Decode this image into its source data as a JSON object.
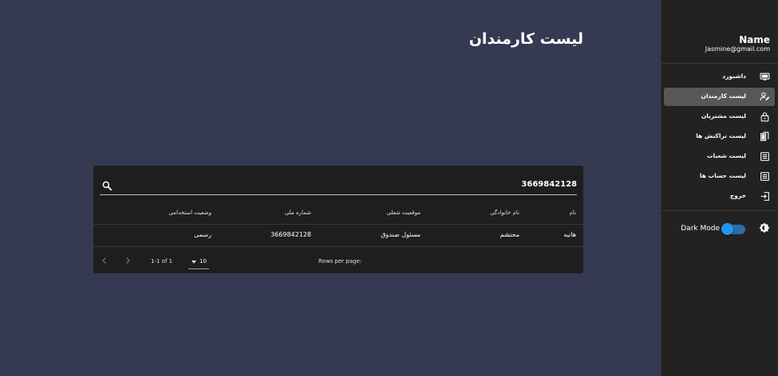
{
  "page": {
    "title": "لیست کارمندان"
  },
  "search": {
    "value": "3669842128"
  },
  "table": {
    "headers": [
      "نام",
      "نام خانوادگی",
      "موقعیت شغلی",
      "شماره ملی",
      "وضعیت استخدامی"
    ],
    "rows": [
      [
        "هانیه",
        "محتشم",
        "مسئول صندوق",
        "3669842128",
        "رسمی"
      ]
    ]
  },
  "pagination": {
    "rows_per_page_label": "Rows per page:",
    "rows_per_page_value": "10",
    "range_text": "1-1 of 1"
  },
  "user": {
    "name": "Name",
    "email": "Jasmine@gmail.com"
  },
  "menu": [
    {
      "label": "داشبورد",
      "icon": "monitor-icon",
      "active": false
    },
    {
      "label": "لیست کارمندان",
      "icon": "user-edit-icon",
      "active": true
    },
    {
      "label": "لیست مشتریان",
      "icon": "lock-icon",
      "active": false
    },
    {
      "label": "لیست تراکنش ها",
      "icon": "documents-icon",
      "active": false
    },
    {
      "label": "لیست شعبات",
      "icon": "list-icon",
      "active": false
    },
    {
      "label": "لیست حساب ها",
      "icon": "list-icon",
      "active": false
    },
    {
      "label": "خروج",
      "icon": "logout-icon",
      "active": false
    }
  ],
  "dark_mode": {
    "label": "Dark Mode",
    "enabled": true
  },
  "colors": {
    "background": "#353a52",
    "sidebar": "#222222",
    "card": "#1e1e1e",
    "active_item": "#575757",
    "toggle": "#2196f3"
  }
}
